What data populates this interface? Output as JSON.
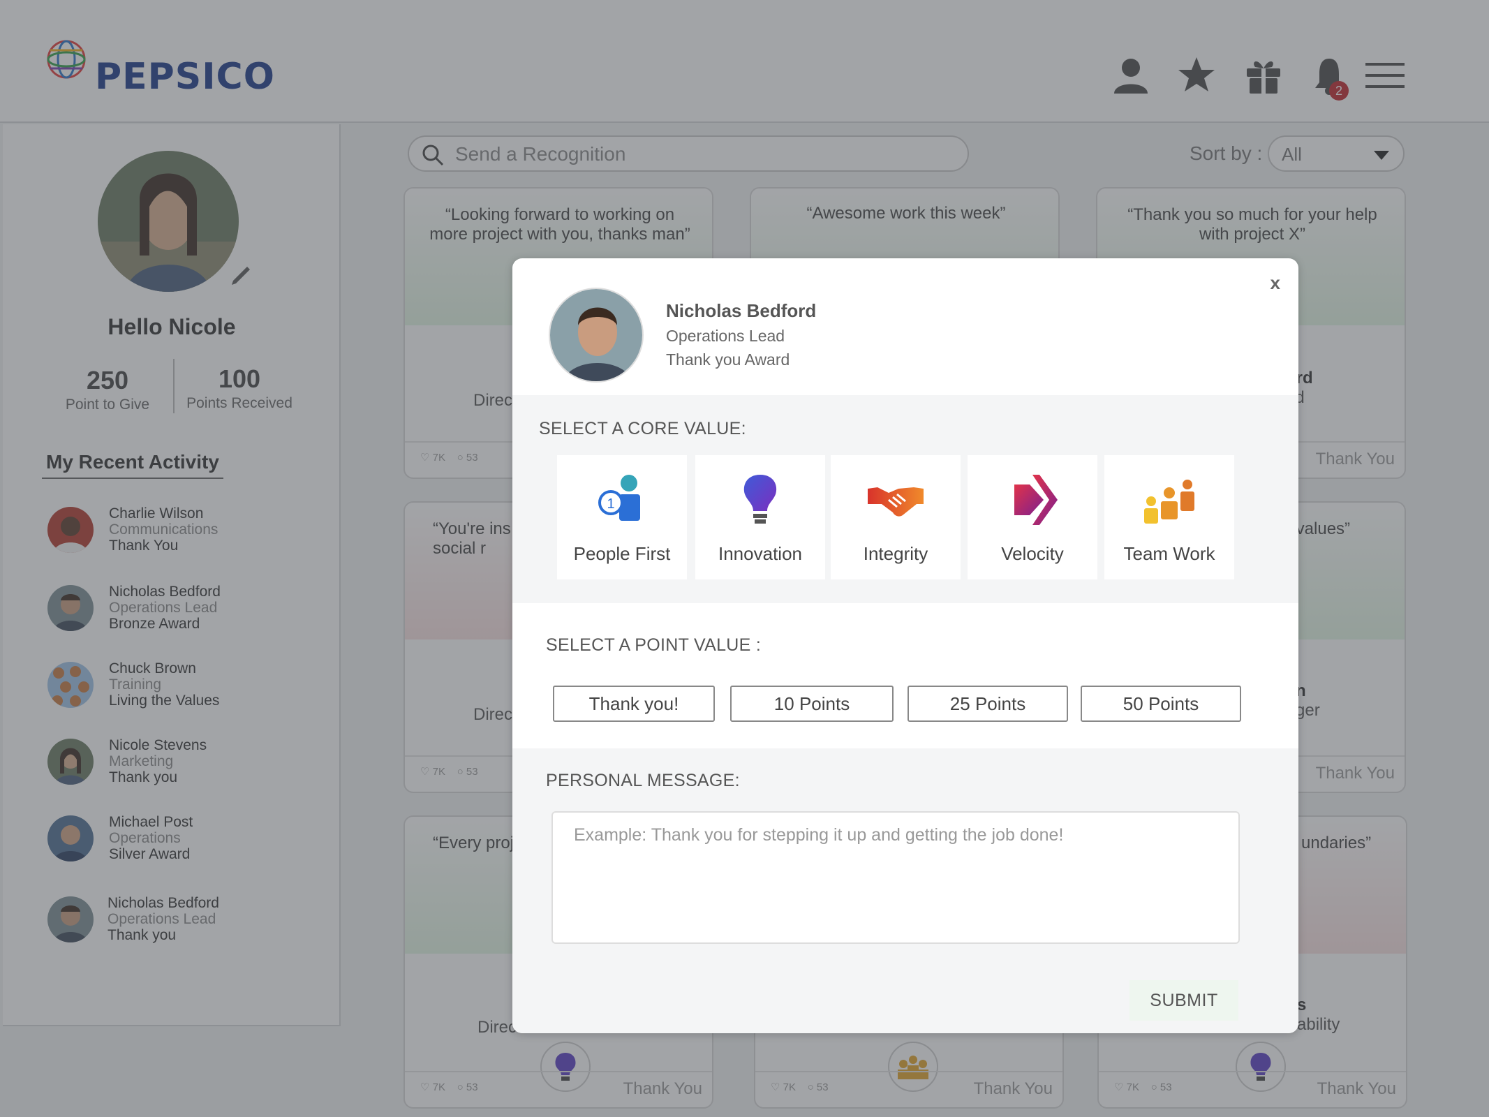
{
  "header": {
    "brand": "PEPSICO",
    "notification_count": "2"
  },
  "profile": {
    "greeting": "Hello Nicole",
    "points_to_give": "250",
    "points_to_give_label": "Point to Give",
    "points_received": "100",
    "points_received_label": "Points Received"
  },
  "recent_activity": {
    "title": "My Recent Activity",
    "items": [
      {
        "name": "Charlie Wilson",
        "dept": "Communications",
        "award": "Thank You"
      },
      {
        "name": "Nicholas Bedford",
        "dept": "Operations Lead",
        "award": "Bronze Award"
      },
      {
        "name": "Chuck Brown",
        "dept": "Training",
        "award": "Living the Values"
      },
      {
        "name": "Nicole Stevens",
        "dept": "Marketing",
        "award": "Thank you"
      },
      {
        "name": "Michael Post",
        "dept": "Operations",
        "award": "Silver Award"
      },
      {
        "name": "Nicholas Bedford",
        "dept": "Operations Lead",
        "award": "Thank you"
      }
    ]
  },
  "search": {
    "placeholder": "Send a Recognition"
  },
  "sort": {
    "label": "Sort by :",
    "value": "All"
  },
  "cards": [
    {
      "quote": "“Looking forward to working on more project with you, thanks man”",
      "person_line": "Direc",
      "likes": "7K",
      "comments": "53",
      "award": ""
    },
    {
      "quote": "“Awesome work this week”",
      "person_line": "",
      "likes": "",
      "comments": "",
      "award": ""
    },
    {
      "quote": "“Thank you so much for your help with project X”",
      "person_name": "ord",
      "person_line": "ad",
      "likes": "",
      "comments": "",
      "award": "Thank You"
    },
    {
      "quote": "“You're ins our social r",
      "person_line": "Direc",
      "likes": "7K",
      "comments": "53",
      "award": ""
    },
    {
      "quote": "“ values”",
      "person_name": "n",
      "person_line": "ger",
      "likes": "",
      "comments": "",
      "award": "Thank You"
    },
    {
      "quote": "“Every proj so with",
      "person_line": "Direc",
      "likes": "7K",
      "comments": "53",
      "award": "Thank You"
    },
    {
      "quote": "",
      "person_line": "",
      "likes": "7K",
      "comments": "53",
      "award": "Thank You"
    },
    {
      "quote": "undaries”",
      "person_name": "s",
      "person_line": "ability",
      "likes": "7K",
      "comments": "53",
      "award": "Thank You"
    }
  ],
  "modal": {
    "close": "x",
    "recipient_name": "Nicholas Bedford",
    "recipient_role": "Operations Lead",
    "recipient_award": "Thank you Award",
    "core_value_title": "SELECT A CORE VALUE:",
    "core_values": [
      {
        "label": "People First",
        "icon": "people-first-icon"
      },
      {
        "label": "Innovation",
        "icon": "lightbulb-icon"
      },
      {
        "label": "Integrity",
        "icon": "handshake-icon"
      },
      {
        "label": "Velocity",
        "icon": "arrow-forward-icon"
      },
      {
        "label": "Team Work",
        "icon": "team-icon"
      }
    ],
    "point_value_title": "SELECT A POINT VALUE :",
    "point_values": [
      "Thank you!",
      "10 Points",
      "25 Points",
      "50 Points"
    ],
    "message_title": "PERSONAL MESSAGE:",
    "message_placeholder": "Example: Thank you for stepping it up and getting the job done!",
    "submit_label": "SUBMIT"
  },
  "colors": {
    "brand_blue": "#1d3a8a",
    "notification_red": "#c0272d",
    "submit_bg": "#eef6ef"
  }
}
